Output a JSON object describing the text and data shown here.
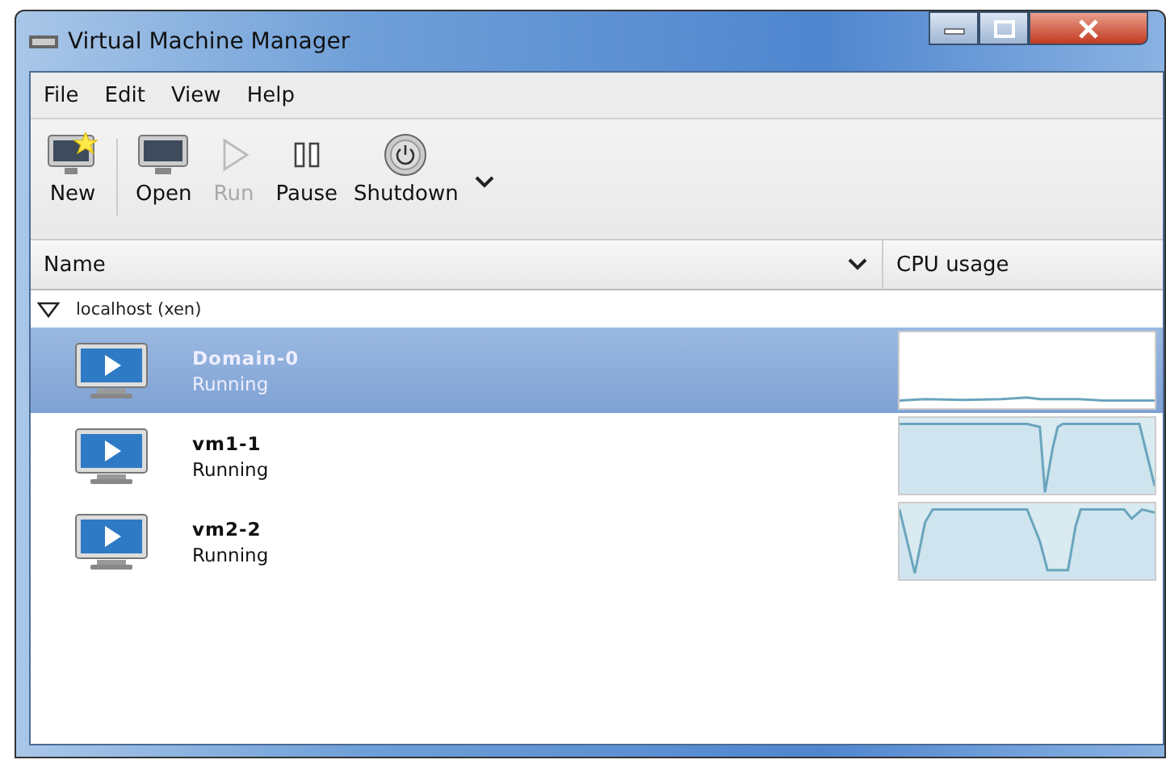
{
  "window": {
    "title": "Virtual Machine Manager"
  },
  "menu": [
    "File",
    "Edit",
    "View",
    "Help"
  ],
  "toolbar": [
    {
      "label": "New",
      "kind": "new",
      "disabled": false
    },
    {
      "label": "Open",
      "kind": "open",
      "disabled": false
    },
    {
      "label": "Run",
      "kind": "run",
      "disabled": true
    },
    {
      "label": "Pause",
      "kind": "pause",
      "disabled": false
    },
    {
      "label": "Shutdown",
      "kind": "shutdown",
      "disabled": false
    }
  ],
  "table": {
    "columns": [
      "Name",
      "CPU usage"
    ],
    "host": {
      "label": "localhost (xen)",
      "expanded": true
    },
    "rows": [
      {
        "name": "Domain-0",
        "status": "Running",
        "selected": true
      },
      {
        "name": "vm1-1",
        "status": "Running",
        "selected": false
      },
      {
        "name": "vm2-2",
        "status": "Running",
        "selected": false
      }
    ]
  }
}
